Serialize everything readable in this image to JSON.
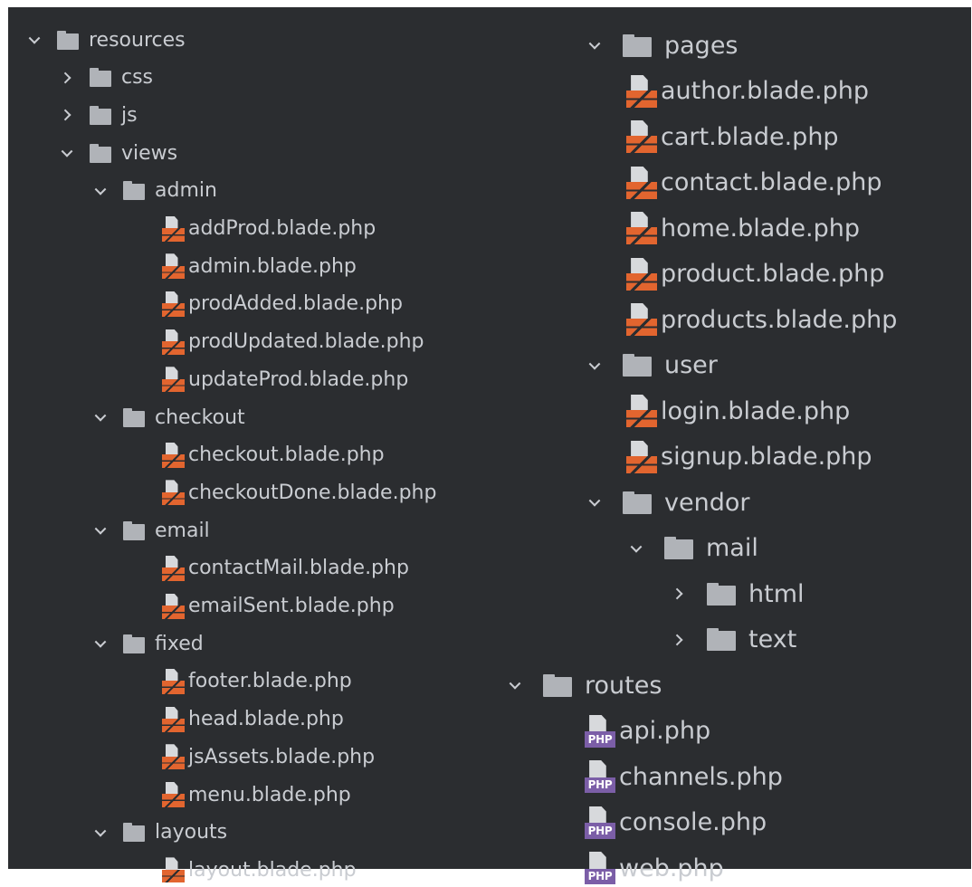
{
  "left_tree": [
    {
      "type": "folder",
      "label": "resources",
      "expanded": true,
      "depth": 0
    },
    {
      "type": "folder",
      "label": "css",
      "expanded": false,
      "depth": 1
    },
    {
      "type": "folder",
      "label": "js",
      "expanded": false,
      "depth": 1
    },
    {
      "type": "folder",
      "label": "views",
      "expanded": true,
      "depth": 1
    },
    {
      "type": "folder",
      "label": "admin",
      "expanded": true,
      "depth": 2
    },
    {
      "type": "blade",
      "label": "addProd.blade.php",
      "depth": 3
    },
    {
      "type": "blade",
      "label": "admin.blade.php",
      "depth": 3
    },
    {
      "type": "blade",
      "label": "prodAdded.blade.php",
      "depth": 3
    },
    {
      "type": "blade",
      "label": "prodUpdated.blade.php",
      "depth": 3
    },
    {
      "type": "blade",
      "label": "updateProd.blade.php",
      "depth": 3
    },
    {
      "type": "folder",
      "label": "checkout",
      "expanded": true,
      "depth": 2
    },
    {
      "type": "blade",
      "label": "checkout.blade.php",
      "depth": 3
    },
    {
      "type": "blade",
      "label": "checkoutDone.blade.php",
      "depth": 3
    },
    {
      "type": "folder",
      "label": "email",
      "expanded": true,
      "depth": 2
    },
    {
      "type": "blade",
      "label": "contactMail.blade.php",
      "depth": 3
    },
    {
      "type": "blade",
      "label": "emailSent.blade.php",
      "depth": 3
    },
    {
      "type": "folder",
      "label": "fixed",
      "expanded": true,
      "depth": 2
    },
    {
      "type": "blade",
      "label": "footer.blade.php",
      "depth": 3
    },
    {
      "type": "blade",
      "label": "head.blade.php",
      "depth": 3
    },
    {
      "type": "blade",
      "label": "jsAssets.blade.php",
      "depth": 3
    },
    {
      "type": "blade",
      "label": "menu.blade.php",
      "depth": 3
    },
    {
      "type": "folder",
      "label": "layouts",
      "expanded": true,
      "depth": 2
    },
    {
      "type": "blade",
      "label": "layout.blade.php",
      "depth": 3
    }
  ],
  "right_tree": [
    {
      "type": "folder",
      "label": "pages",
      "expanded": true,
      "depth": 2
    },
    {
      "type": "blade",
      "label": "author.blade.php",
      "depth": 3
    },
    {
      "type": "blade",
      "label": "cart.blade.php",
      "depth": 3
    },
    {
      "type": "blade",
      "label": "contact.blade.php",
      "depth": 3
    },
    {
      "type": "blade",
      "label": "home.blade.php",
      "depth": 3
    },
    {
      "type": "blade",
      "label": "product.blade.php",
      "depth": 3
    },
    {
      "type": "blade",
      "label": "products.blade.php",
      "depth": 3
    },
    {
      "type": "folder",
      "label": "user",
      "expanded": true,
      "depth": 2
    },
    {
      "type": "blade",
      "label": "login.blade.php",
      "depth": 3
    },
    {
      "type": "blade",
      "label": "signup.blade.php",
      "depth": 3
    },
    {
      "type": "folder",
      "label": "vendor",
      "expanded": true,
      "depth": 2
    },
    {
      "type": "folder",
      "label": "mail",
      "expanded": true,
      "depth": 3
    },
    {
      "type": "folder",
      "label": "html",
      "expanded": false,
      "depth": 4
    },
    {
      "type": "folder",
      "label": "text",
      "expanded": false,
      "depth": 4
    },
    {
      "type": "folder",
      "label": "routes",
      "expanded": true,
      "depth": 1
    },
    {
      "type": "php",
      "label": "api.php",
      "depth": 2
    },
    {
      "type": "php",
      "label": "channels.php",
      "depth": 2
    },
    {
      "type": "php",
      "label": "console.php",
      "depth": 2
    },
    {
      "type": "php",
      "label": "web.php",
      "depth": 2
    }
  ],
  "icons": {
    "folder": "folder-icon",
    "blade": "blade-file-icon",
    "php": "php-file-icon",
    "php_badge": "PHP"
  },
  "colors": {
    "background": "#2b2d30",
    "text": "#c9ccd1",
    "folder": "#b0b3b8",
    "blade": "#e2652f",
    "php": "#7b5ea7"
  }
}
